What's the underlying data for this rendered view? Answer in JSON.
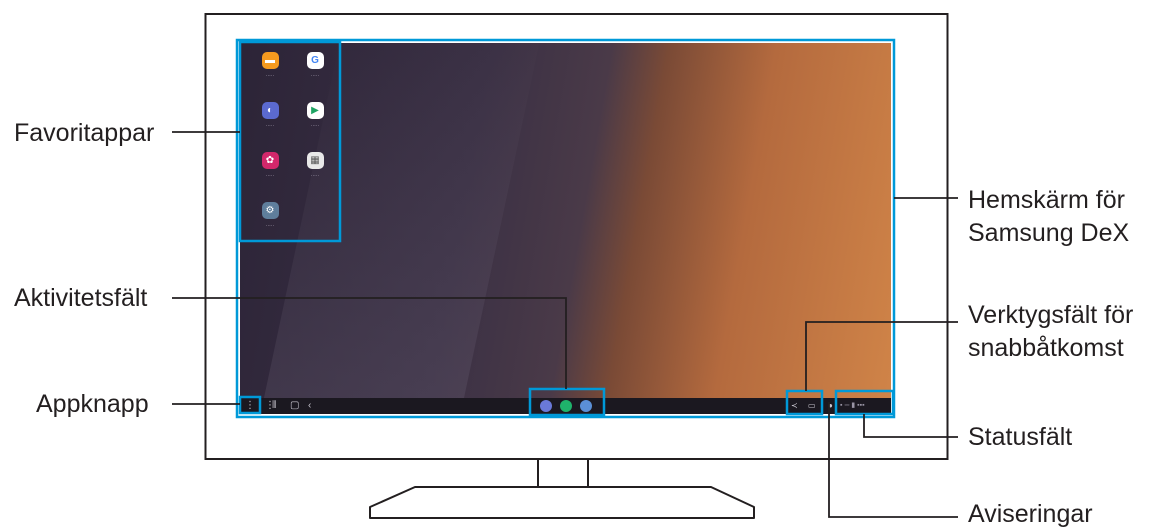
{
  "labels": {
    "favorite_apps": "Favoritappar",
    "taskbar": "Aktivitetsfält",
    "app_button": "Appknapp",
    "home_screen_line1": "Hemskärm för",
    "home_screen_line2": "Samsung DeX",
    "quick_access_line1": "Verktygsfält för",
    "quick_access_line2": "snabbåtkomst",
    "status_bar": "Statusfält",
    "notifications": "Aviseringar"
  },
  "colors": {
    "callout_line": "#0099d8",
    "monitor_stroke": "#231f20",
    "text": "#231f20"
  },
  "favorite_apps": [
    {
      "icon": "my-files-icon",
      "color": "#f59a1f",
      "glyph": "▬"
    },
    {
      "icon": "google-icon",
      "color": "#ffffff",
      "glyph": "G"
    },
    {
      "icon": "samsung-internet-icon",
      "color": "#5b6ad0",
      "glyph": "◐"
    },
    {
      "icon": "play-store-icon",
      "color": "#ffffff",
      "glyph": "▶"
    },
    {
      "icon": "gallery-icon",
      "color": "#d2286b",
      "glyph": "✿"
    },
    {
      "icon": "google-folder-icon",
      "color": "#e9e9e9",
      "glyph": "▦"
    },
    {
      "icon": "settings-icon",
      "color": "#5f7e9c",
      "glyph": "⚙"
    }
  ],
  "taskbar_apps": [
    {
      "icon": "internet-app-icon",
      "color": "#6a79d8"
    },
    {
      "icon": "phone-app-icon",
      "color": "#1fb36b"
    },
    {
      "icon": "camera-app-icon",
      "color": "#5b8fd6"
    }
  ]
}
